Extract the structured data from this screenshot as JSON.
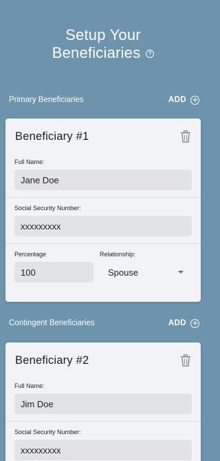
{
  "header": {
    "title_line1": "Setup Your",
    "title_line2": "Beneficiaries",
    "help_glyph": "?"
  },
  "primary": {
    "section_title": "Primary Beneficiaries",
    "add_label": "ADD",
    "card": {
      "title": "Beneficiary #1",
      "full_name_label": "Full Name:",
      "full_name_value": "Jane Doe",
      "ssn_label": "Social Security Number:",
      "ssn_value": "xxxxxxxxx",
      "percentage_label": "Percentage",
      "percentage_value": "100",
      "relationship_label": "Relationship:",
      "relationship_value": "Spouse"
    }
  },
  "contingent": {
    "section_title": "Contingent Beneficiaries",
    "add_label": "ADD",
    "card": {
      "title": "Beneficiary #2",
      "full_name_label": "Full Name:",
      "full_name_value": "Jim Doe",
      "ssn_label": "Social Security Number:",
      "ssn_value": "xxxxxxxxx"
    }
  },
  "colors": {
    "background": "#6d93ad",
    "card": "#f2f3f7",
    "input": "#e3e3e5"
  },
  "icons": {
    "help": "help-icon",
    "add": "add-circle-icon",
    "delete": "trash-icon",
    "dropdown": "chevron-down-icon"
  }
}
